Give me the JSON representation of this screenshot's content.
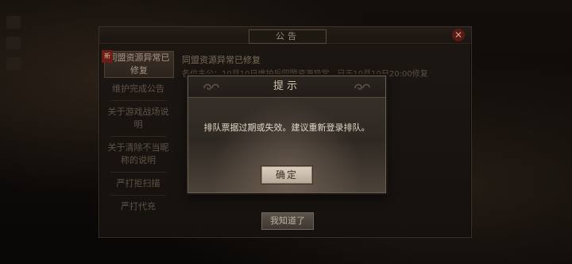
{
  "announcement": {
    "title": "公告",
    "close_label": "✕",
    "sidebar": [
      {
        "label": "同盟资源异常已修复",
        "active": true,
        "badge": "新"
      },
      {
        "label": "维护完成公告"
      },
      {
        "label": "关于游戏战场说明"
      },
      {
        "label": "关于清除不当昵称的说明"
      },
      {
        "label": "严打拒扫描"
      },
      {
        "label": "严打代充"
      }
    ],
    "content_title": "同盟资源异常已修复",
    "content_body": "各位主公：10月10日维护后同盟资源异常，已于10月10日20:00修复",
    "ok_button": "我知道了"
  },
  "prompt": {
    "title": "提示",
    "message": "排队票据过期或失效。建议重新登录排队。",
    "confirm_button": "确定"
  }
}
